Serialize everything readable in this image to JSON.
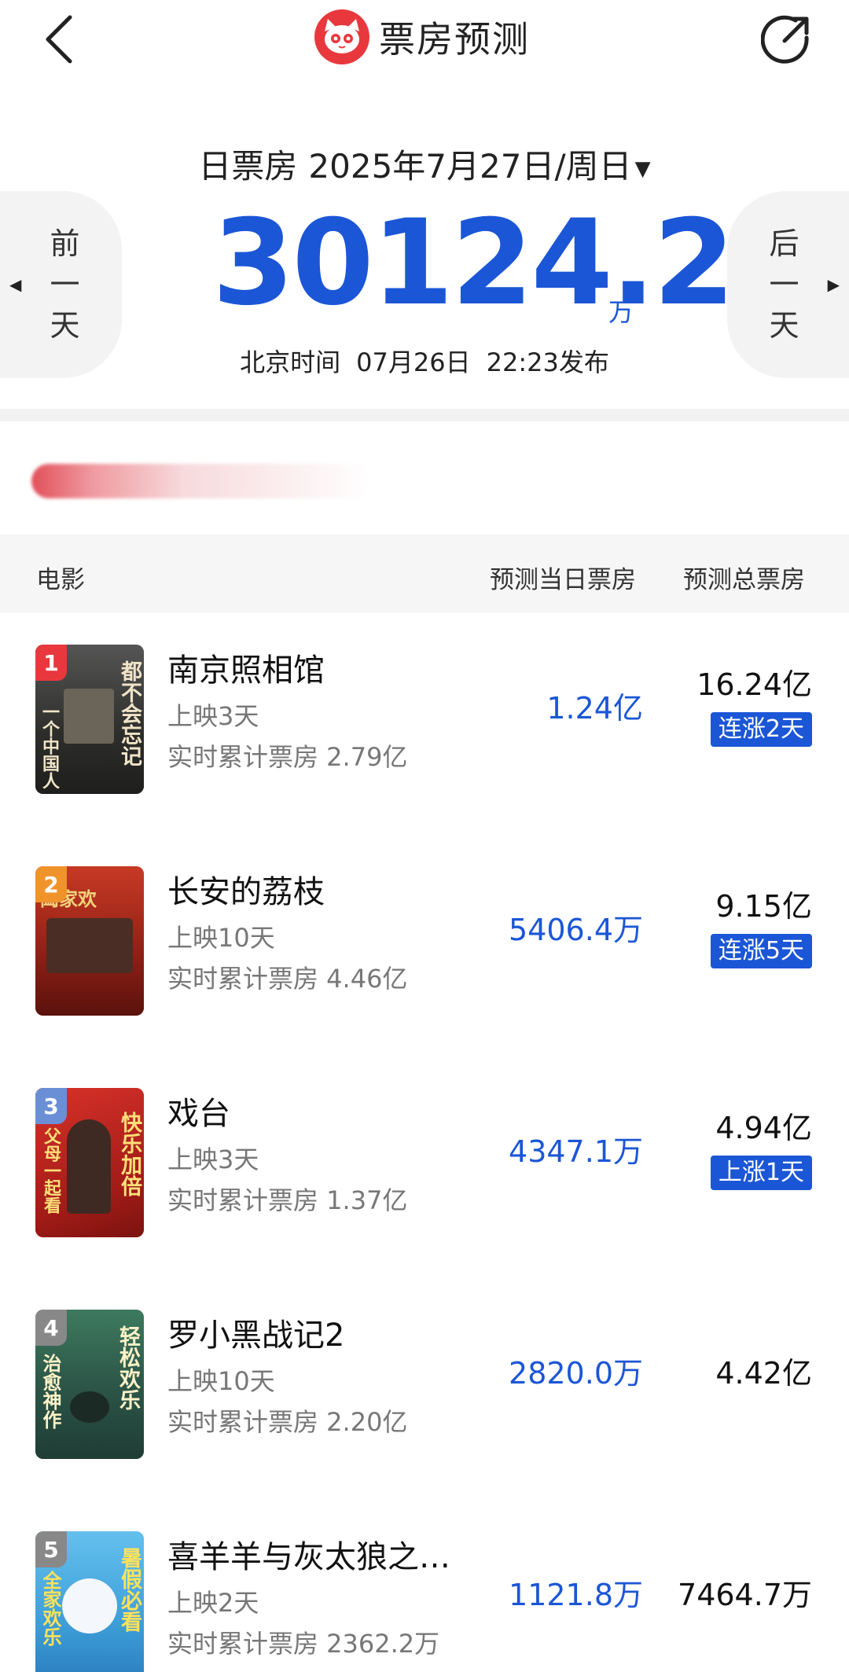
{
  "header": {
    "title": "票房预测",
    "back_icon": "chevron-left-icon",
    "share_icon": "share-icon",
    "logo_icon": "cat-logo-icon"
  },
  "summary": {
    "date_label": "日票房",
    "date": "2025年7月27日/周日",
    "total_value": "30124.2",
    "total_unit": "万",
    "prev_chars": [
      "前",
      "一",
      "天"
    ],
    "next_chars": [
      "后",
      "一",
      "天"
    ],
    "publish_label": "北京时间",
    "publish_date": "07月26日",
    "publish_time": "22:23发布"
  },
  "table": {
    "col_movie": "电影",
    "col_day": "预测当日票房",
    "col_total": "预测总票房"
  },
  "movies": [
    {
      "rank": "1",
      "rank_color": "#e8383d",
      "name": "南京照相馆",
      "days": "上映3天",
      "cum": "实时累计票房 2.79亿",
      "day_pred": "1.24亿",
      "total_pred": "16.24亿",
      "trend": "连涨2天",
      "poster_bg": "#3a3a38",
      "poster_text_a": "都不会忘记",
      "poster_text_b": "一个中国人"
    },
    {
      "rank": "2",
      "rank_color": "#f0932b",
      "name": "长安的荔枝",
      "days": "上映10天",
      "cum": "实时累计票房 4.46亿",
      "day_pred": "5406.4万",
      "total_pred": "9.15亿",
      "trend": "连涨5天",
      "poster_bg": "#a8261c",
      "poster_text_a": "阖家欢",
      "poster_text_b": ""
    },
    {
      "rank": "3",
      "rank_color": "#6b8fd6",
      "name": "戏台",
      "days": "上映3天",
      "cum": "实时累计票房 1.37亿",
      "day_pred": "4347.1万",
      "total_pred": "4.94亿",
      "trend": "上涨1天",
      "poster_bg": "#b8221e",
      "poster_text_a": "快乐加倍",
      "poster_text_b": "父母一起看"
    },
    {
      "rank": "4",
      "rank_color": "#888888",
      "name": "罗小黑战记2",
      "days": "上映10天",
      "cum": "实时累计票房 2.20亿",
      "day_pred": "2820.0万",
      "total_pred": "4.42亿",
      "trend": "",
      "poster_bg": "#2f5a4a",
      "poster_text_a": "轻松欢乐",
      "poster_text_b": "治愈神作"
    },
    {
      "rank": "5",
      "rank_color": "#888888",
      "name": "喜羊羊与灰太狼之…",
      "days": "上映2天",
      "cum": "实时累计票房 2362.2万",
      "day_pred": "1121.8万",
      "total_pred": "7464.7万",
      "trend": "",
      "poster_bg": "#3f9fd8",
      "poster_text_a": "暑假必看",
      "poster_text_b": "全家欢乐"
    }
  ]
}
